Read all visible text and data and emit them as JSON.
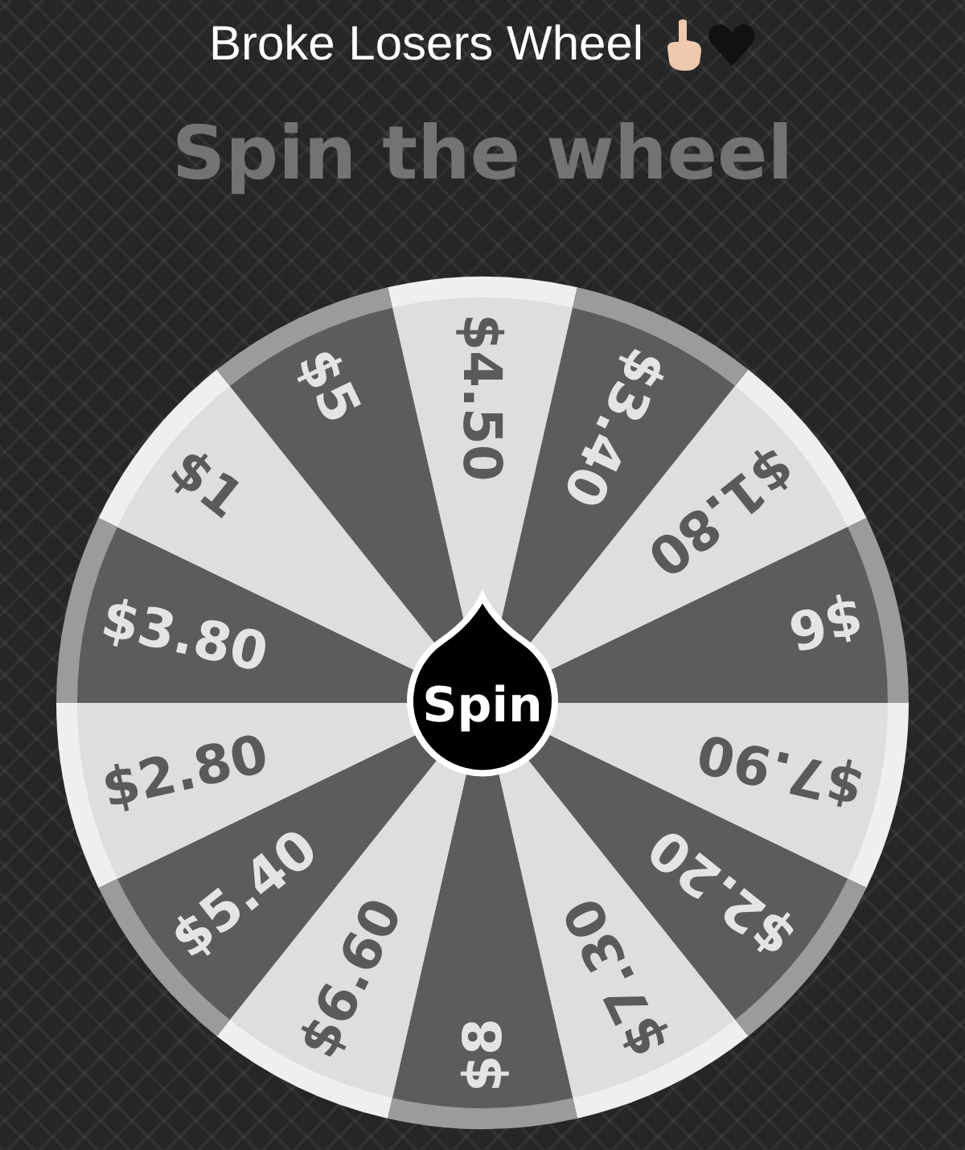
{
  "title": "Broke Losers Wheel",
  "heading": "Spin the wheel",
  "wheel": {
    "segments": [
      {
        "label": "$4.50"
      },
      {
        "label": "$3.40"
      },
      {
        "label": "$1.80"
      },
      {
        "label": "$6"
      },
      {
        "label": "$7.90"
      },
      {
        "label": "$2.20"
      },
      {
        "label": "$7.30"
      },
      {
        "label": "$8"
      },
      {
        "label": "$6.60"
      },
      {
        "label": "$5.40"
      },
      {
        "label": "$2.80"
      },
      {
        "label": "$3.80"
      },
      {
        "label": "$1"
      },
      {
        "label": "$5"
      }
    ],
    "spin_button": "Spin"
  }
}
